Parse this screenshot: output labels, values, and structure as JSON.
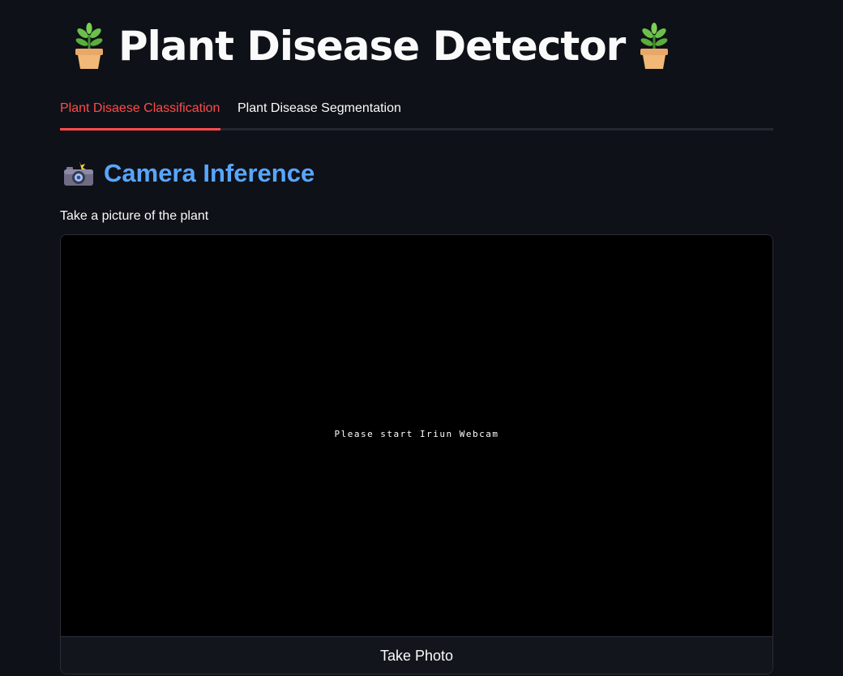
{
  "header": {
    "title": "Plant Disease Detector",
    "left_icon": "potted-plant-icon",
    "right_icon": "potted-plant-icon"
  },
  "tabs": [
    {
      "label": "Plant Disaese Classification",
      "active": true
    },
    {
      "label": "Plant Disease Segmentation",
      "active": false
    }
  ],
  "section": {
    "icon": "camera-with-flash-icon",
    "title": "Camera Inference"
  },
  "camera_input": {
    "label": "Take a picture of the plant",
    "feed_message": "Please start Iriun Webcam",
    "button_label": "Take Photo"
  },
  "colors": {
    "background": "#0e1117",
    "active_tab": "#ff4b4b",
    "heading_blue": "#58a6ff",
    "text": "#fafafa"
  }
}
